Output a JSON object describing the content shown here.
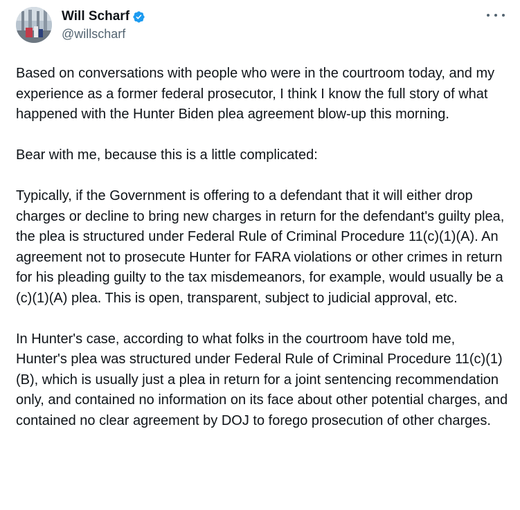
{
  "author": {
    "display_name": "Will Scharf",
    "handle": "@willscharf",
    "verified": true,
    "verified_color": "#1d9bf0"
  },
  "more_icon": "more-horizontal-icon",
  "tweet": {
    "paragraphs": [
      "Based on conversations with people who were in the courtroom today, and my experience as a former federal prosecutor, I think I know the full story of what happened with the Hunter Biden plea agreement blow-up this morning.",
      "Bear with me, because this is a little complicated:",
      "Typically, if the Government is offering to a defendant that it will either drop charges or decline to bring new charges in return for the defendant's guilty plea, the plea is structured under Federal Rule of Criminal Procedure 11(c)(1)(A).  An agreement not to prosecute Hunter for FARA violations or other crimes in return for his pleading guilty to the tax misdemeanors, for example, would usually be a (c)(1)(A) plea.  This is open, transparent, subject to judicial approval, etc.",
      "In Hunter's case, according to what folks in the courtroom have told me, Hunter's plea was structured under Federal Rule of Criminal Procedure 11(c)(1)(B), which is usually just a plea in return for a joint sentencing recommendation only, and contained no information on its face about other potential charges, and contained no clear agreement by DOJ to forego prosecution of other charges."
    ]
  }
}
